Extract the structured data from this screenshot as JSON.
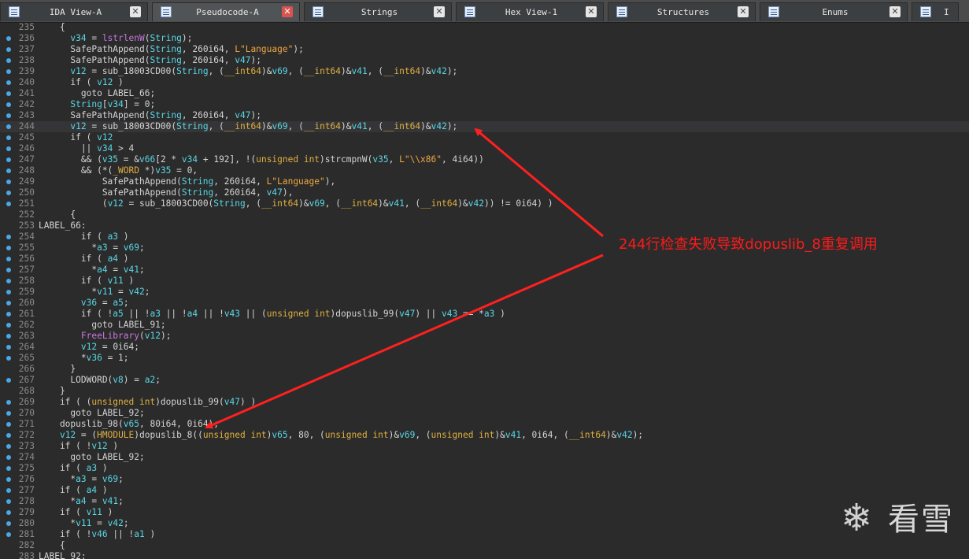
{
  "tabs": [
    {
      "label": "IDA View-A",
      "icon": "ida-view-icon",
      "active": false
    },
    {
      "label": "Pseudocode-A",
      "icon": "pseudocode-icon",
      "active": true
    },
    {
      "label": "Strings",
      "icon": "strings-icon",
      "active": false
    },
    {
      "label": "Hex View-1",
      "icon": "hex-view-icon",
      "active": false
    },
    {
      "label": "Structures",
      "icon": "structures-icon",
      "active": false
    },
    {
      "label": "Enums",
      "icon": "enums-icon",
      "active": false
    },
    {
      "label": "I",
      "icon": "imports-icon",
      "active": false
    }
  ],
  "close_glyph": "✕",
  "code": {
    "first_line": 235,
    "highlighted_line": 244,
    "lines": [
      {
        "n": "235",
        "dot": false,
        "html": "    {"
      },
      {
        "n": "236",
        "dot": true,
        "html": "      <span class='v'>v34</span> = <span class='p'>lstrlenW</span>(<span class='v'>String</span>);"
      },
      {
        "n": "237",
        "dot": true,
        "html": "      SafePathAppend(<span class='v'>String</span>, 260i64, <span class='s'>L\"Language\"</span>);"
      },
      {
        "n": "238",
        "dot": true,
        "html": "      SafePathAppend(<span class='v'>String</span>, 260i64, <span class='v'>v47</span>);"
      },
      {
        "n": "239",
        "dot": true,
        "html": "      <span class='v'>v12</span> = sub_18003CD00(<span class='v'>String</span>, (<span class='k'>__int64</span>)&amp;<span class='v'>v69</span>, (<span class='k'>__int64</span>)&amp;<span class='v'>v41</span>, (<span class='k'>__int64</span>)&amp;<span class='v'>v42</span>);"
      },
      {
        "n": "240",
        "dot": true,
        "html": "      if ( <span class='v'>v12</span> )"
      },
      {
        "n": "241",
        "dot": true,
        "html": "        goto LABEL_66;"
      },
      {
        "n": "242",
        "dot": true,
        "html": "      <span class='v'>String</span>[<span class='v'>v34</span>] = 0;"
      },
      {
        "n": "243",
        "dot": true,
        "html": "      SafePathAppend(<span class='v'>String</span>, 260i64, <span class='v'>v47</span>);"
      },
      {
        "n": "244",
        "dot": true,
        "html": "      <span class='v'>v12</span> = sub_18003CD00(<span class='v'>String</span>, (<span class='k'>__int64</span>)&amp;<span class='v'>v69</span>, (<span class='k'>__int64</span>)&amp;<span class='v'>v41</span>, (<span class='k'>__int64</span>)&amp;<span class='v'>v42</span>);"
      },
      {
        "n": "245",
        "dot": true,
        "html": "      if ( <span class='v'>v12</span>"
      },
      {
        "n": "246",
        "dot": true,
        "html": "        || <span class='v'>v34</span> &gt; 4"
      },
      {
        "n": "247",
        "dot": true,
        "html": "        &amp;&amp; (<span class='v'>v35</span> = &amp;<span class='v'>v66</span>[2 * <span class='v'>v34</span> + 192], !(<span class='k'>unsigned int</span>)strcmpnW(<span class='v'>v35</span>, <span class='s'>L\"\\\\x86\"</span>, 4i64))"
      },
      {
        "n": "248",
        "dot": true,
        "html": "        &amp;&amp; (*(<span class='k'>_WORD</span> *)<span class='v'>v35</span> = 0,"
      },
      {
        "n": "249",
        "dot": true,
        "html": "            SafePathAppend(<span class='v'>String</span>, 260i64, <span class='s'>L\"Language\"</span>),"
      },
      {
        "n": "250",
        "dot": true,
        "html": "            SafePathAppend(<span class='v'>String</span>, 260i64, <span class='v'>v47</span>),"
      },
      {
        "n": "251",
        "dot": true,
        "html": "            (<span class='v'>v12</span> = sub_18003CD00(<span class='v'>String</span>, (<span class='k'>__int64</span>)&amp;<span class='v'>v69</span>, (<span class='k'>__int64</span>)&amp;<span class='v'>v41</span>, (<span class='k'>__int64</span>)&amp;<span class='v'>v42</span>)) != 0i64) )"
      },
      {
        "n": "252",
        "dot": false,
        "html": "      {"
      },
      {
        "n": "253",
        "dot": false,
        "html": "LABEL_66:"
      },
      {
        "n": "254",
        "dot": true,
        "html": "        if ( <span class='v'>a3</span> )"
      },
      {
        "n": "255",
        "dot": true,
        "html": "          *<span class='v'>a3</span> = <span class='v'>v69</span>;"
      },
      {
        "n": "256",
        "dot": true,
        "html": "        if ( <span class='v'>a4</span> )"
      },
      {
        "n": "257",
        "dot": true,
        "html": "          *<span class='v'>a4</span> = <span class='v'>v41</span>;"
      },
      {
        "n": "258",
        "dot": true,
        "html": "        if ( <span class='v'>v11</span> )"
      },
      {
        "n": "259",
        "dot": true,
        "html": "          *<span class='v'>v11</span> = <span class='v'>v42</span>;"
      },
      {
        "n": "260",
        "dot": true,
        "html": "        <span class='v'>v36</span> = <span class='v'>a5</span>;"
      },
      {
        "n": "261",
        "dot": true,
        "html": "        if ( !<span class='v'>a5</span> || !<span class='v'>a3</span> || !<span class='v'>a4</span> || !<span class='v'>v43</span> || (<span class='k'>unsigned int</span>)dopuslib_99(<span class='v'>v47</span>) || <span class='v'>v43</span> == *<span class='v'>a3</span> )"
      },
      {
        "n": "262",
        "dot": true,
        "html": "          goto LABEL_91;"
      },
      {
        "n": "263",
        "dot": true,
        "html": "        <span class='p'>FreeLibrary</span>(<span class='v'>v12</span>);"
      },
      {
        "n": "264",
        "dot": true,
        "html": "        <span class='v'>v12</span> = 0i64;"
      },
      {
        "n": "265",
        "dot": true,
        "html": "        *<span class='v'>v36</span> = 1;"
      },
      {
        "n": "266",
        "dot": false,
        "html": "      }"
      },
      {
        "n": "267",
        "dot": true,
        "html": "      LODWORD(<span class='v'>v8</span>) = <span class='v'>a2</span>;"
      },
      {
        "n": "268",
        "dot": false,
        "html": "    }"
      },
      {
        "n": "269",
        "dot": true,
        "html": "    if ( (<span class='k'>unsigned int</span>)dopuslib_99(<span class='v'>v47</span>) )"
      },
      {
        "n": "270",
        "dot": true,
        "html": "      goto LABEL_92;"
      },
      {
        "n": "271",
        "dot": true,
        "html": "    dopuslib_98(<span class='v'>v65</span>, 80i64, 0i64);"
      },
      {
        "n": "272",
        "dot": true,
        "html": "    <span class='v'>v12</span> = (<span class='k'>HMODULE</span>)dopuslib_8((<span class='k'>unsigned int</span>)<span class='v'>v65</span>, 80, (<span class='k'>unsigned int</span>)&amp;<span class='v'>v69</span>, (<span class='k'>unsigned int</span>)&amp;<span class='v'>v41</span>, 0i64, (<span class='k'>__int64</span>)&amp;<span class='v'>v42</span>);"
      },
      {
        "n": "273",
        "dot": true,
        "html": "    if ( !<span class='v'>v12</span> )"
      },
      {
        "n": "274",
        "dot": true,
        "html": "      goto LABEL_92;"
      },
      {
        "n": "275",
        "dot": true,
        "html": "    if ( <span class='v'>a3</span> )"
      },
      {
        "n": "276",
        "dot": true,
        "html": "      *<span class='v'>a3</span> = <span class='v'>v69</span>;"
      },
      {
        "n": "277",
        "dot": true,
        "html": "    if ( <span class='v'>a4</span> )"
      },
      {
        "n": "278",
        "dot": true,
        "html": "      *<span class='v'>a4</span> = <span class='v'>v41</span>;"
      },
      {
        "n": "279",
        "dot": true,
        "html": "    if ( <span class='v'>v11</span> )"
      },
      {
        "n": "280",
        "dot": true,
        "html": "      *<span class='v'>v11</span> = <span class='v'>v42</span>;"
      },
      {
        "n": "281",
        "dot": true,
        "html": "    if ( !<span class='v'>v46</span> || !<span class='v'>a1</span> )"
      },
      {
        "n": "282",
        "dot": false,
        "html": "    {"
      },
      {
        "n": "283",
        "dot": false,
        "html": "LABEL_92:"
      }
    ]
  },
  "annotation": {
    "text": "244行检查失败导致dopuslib_8重复调用",
    "color": "#ff1a1a"
  },
  "watermark": {
    "text": "看雪",
    "icon": "snowflake-icon"
  },
  "colors": {
    "background": "#2b2b2b",
    "variable": "#59d7e6",
    "keyword_type": "#e0b040",
    "string": "#f0a742",
    "import_func": "#c678dd",
    "arrow": "#ff2020"
  }
}
